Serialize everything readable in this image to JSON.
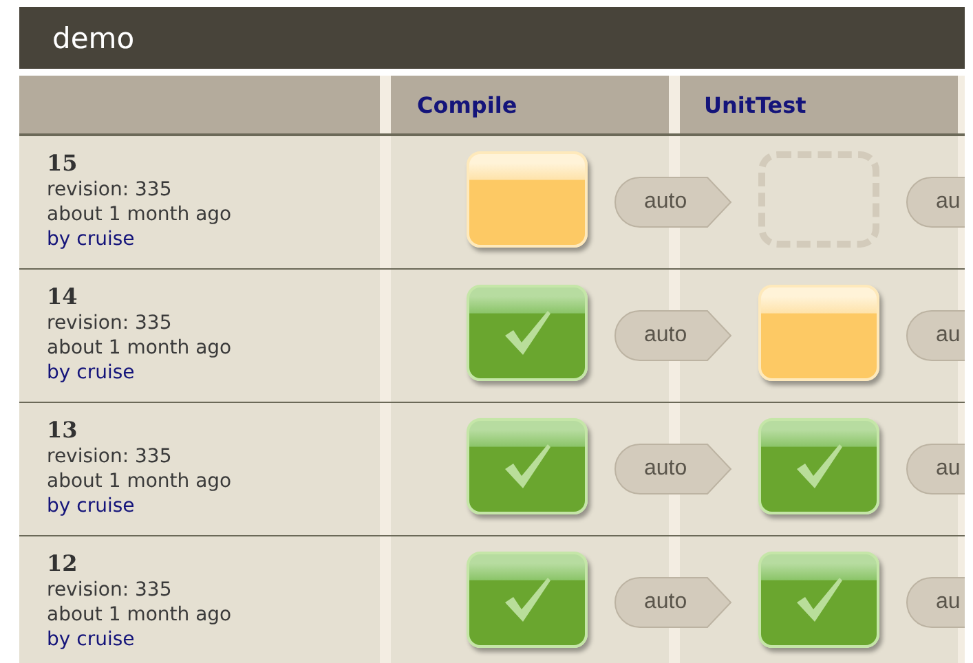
{
  "pipeline": {
    "title": "demo"
  },
  "stages": [
    "Compile",
    "UnitTest"
  ],
  "runs": [
    {
      "label": "15",
      "revision": "revision: 335",
      "time": "about 1 month ago",
      "author": "by cruise",
      "stages": [
        {
          "kind": "building",
          "trigger": "auto"
        },
        {
          "kind": "pending",
          "trigger": "au"
        }
      ]
    },
    {
      "label": "14",
      "revision": "revision: 335",
      "time": "about 1 month ago",
      "author": "by cruise",
      "stages": [
        {
          "kind": "passed",
          "trigger": "auto"
        },
        {
          "kind": "building",
          "trigger": "au"
        }
      ]
    },
    {
      "label": "13",
      "revision": "revision: 335",
      "time": "about 1 month ago",
      "author": "by cruise",
      "stages": [
        {
          "kind": "passed",
          "trigger": "auto"
        },
        {
          "kind": "passed",
          "trigger": "au"
        }
      ]
    },
    {
      "label": "12",
      "revision": "revision: 335",
      "time": "about 1 month ago",
      "author": "by cruise",
      "stages": [
        {
          "kind": "passed",
          "trigger": "auto"
        },
        {
          "kind": "passed",
          "trigger": "au"
        }
      ]
    }
  ]
}
